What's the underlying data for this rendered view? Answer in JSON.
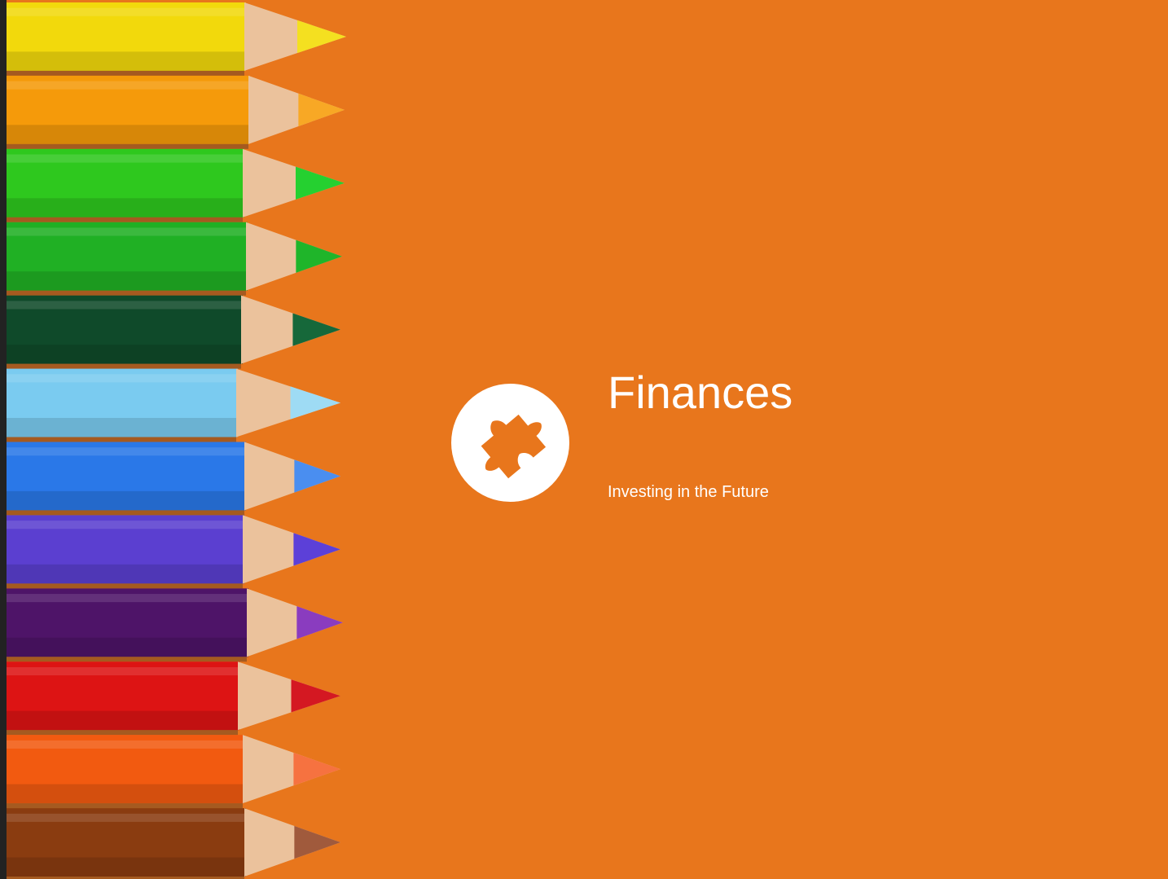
{
  "slide": {
    "title": "Finances",
    "subtitle": "Investing in the Future",
    "background_color": "#E8761C",
    "icon": "puzzle-piece-icon"
  },
  "pencils": [
    {
      "color": "#F2D90C",
      "tip": "#F4E020"
    },
    {
      "color": "#F59A0A",
      "tip": "#F8A825"
    },
    {
      "color": "#2EC81E",
      "tip": "#25D030"
    },
    {
      "color": "#20B024",
      "tip": "#1FB52A"
    },
    {
      "color": "#0F4A2A",
      "tip": "#16683A"
    },
    {
      "color": "#7ACBF0",
      "tip": "#9EDBF4"
    },
    {
      "color": "#2A78E8",
      "tip": "#4A8EF0"
    },
    {
      "color": "#5B3FD0",
      "tip": "#5C40D8"
    },
    {
      "color": "#4E1468",
      "tip": "#8A3CBF"
    },
    {
      "color": "#DD1414",
      "tip": "#D41822"
    },
    {
      "color": "#F25A10",
      "tip": "#F67240"
    },
    {
      "color": "#8A3C10",
      "tip": "#A05A3C"
    }
  ]
}
